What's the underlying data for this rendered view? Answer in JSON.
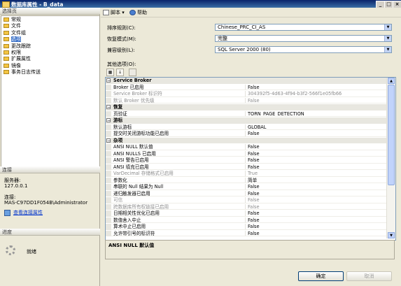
{
  "window": {
    "title": "数据库属性 - B_data",
    "minimize": "_",
    "maximize": "□",
    "close": "×"
  },
  "left": {
    "select_page_header": "选择页",
    "pages": [
      "常规",
      "文件",
      "文件组",
      "选项",
      "更改跟踪",
      "权限",
      "扩展属性",
      "镜像",
      "事务日志传送"
    ],
    "selected_index": 3,
    "connection_header": "连接",
    "server_label": "服务器:",
    "server_value": "127.0.0.1",
    "connection_label": "连接:",
    "connection_value": "MAS-C97DD1F054B\\Administrator",
    "view_connection_link": "查看连接属性",
    "progress_header": "进度",
    "progress_status": "就绪"
  },
  "toolbar": {
    "script_label": "脚本",
    "dropdown_glyph": "▾",
    "help_label": "帮助"
  },
  "form": {
    "collation_label": "排序规则(C):",
    "collation_value": "Chinese_PRC_CI_AS",
    "recovery_label": "恢复模式(M):",
    "recovery_value": "完整",
    "compat_label": "兼容级别(L):",
    "compat_value": "SQL Server 2000 (80)",
    "other_options_label": "其他选项(O):"
  },
  "grid": {
    "rows": [
      {
        "kind": "cat",
        "name": "Service Broker"
      },
      {
        "kind": "prop",
        "name": "Broker 已启用",
        "value": "False"
      },
      {
        "kind": "dis",
        "name": "Service Broker 标识符",
        "value": "304392f5-4d63-4f94-b3f2-566f1e05fb66"
      },
      {
        "kind": "dis",
        "name": "默认 Broker 优先级",
        "value": "False"
      },
      {
        "kind": "cat",
        "name": "恢复"
      },
      {
        "kind": "prop",
        "name": "页验证",
        "value": "TORN_PAGE_DETECTION"
      },
      {
        "kind": "cat",
        "name": "游标"
      },
      {
        "kind": "prop",
        "name": "默认游标",
        "value": "GLOBAL"
      },
      {
        "kind": "prop",
        "name": "提交时关闭游标功能已启用",
        "value": "False"
      },
      {
        "kind": "cat",
        "name": "杂项"
      },
      {
        "kind": "prop",
        "name": "ANSI NULL 默认值",
        "value": "False"
      },
      {
        "kind": "prop",
        "name": "ANSI NULLS 已启用",
        "value": "False"
      },
      {
        "kind": "prop",
        "name": "ANSI 警告已启用",
        "value": "False"
      },
      {
        "kind": "prop",
        "name": "ANSI 填充已启用",
        "value": "False"
      },
      {
        "kind": "dis",
        "name": "VarDecimal 存储格式已启用",
        "value": "True"
      },
      {
        "kind": "prop",
        "name": "参数化",
        "value": "简单"
      },
      {
        "kind": "prop",
        "name": "串联的 Null 结果为 Null",
        "value": "False"
      },
      {
        "kind": "prop",
        "name": "递归触发器已启用",
        "value": "False"
      },
      {
        "kind": "dis",
        "name": "可信",
        "value": "False"
      },
      {
        "kind": "dis",
        "name": "跨数据库所有权链接已启用",
        "value": "False"
      },
      {
        "kind": "prop",
        "name": "日期相关性优化已启用",
        "value": "False"
      },
      {
        "kind": "prop",
        "name": "数值舍入中止",
        "value": "False"
      },
      {
        "kind": "prop",
        "name": "算术中止已启用",
        "value": "False"
      },
      {
        "kind": "prop",
        "name": "允许带引号的标识符",
        "value": "False"
      }
    ],
    "description_title": "ANSI NULL 默认值"
  },
  "buttons": {
    "ok": "确定",
    "cancel": "取消"
  }
}
